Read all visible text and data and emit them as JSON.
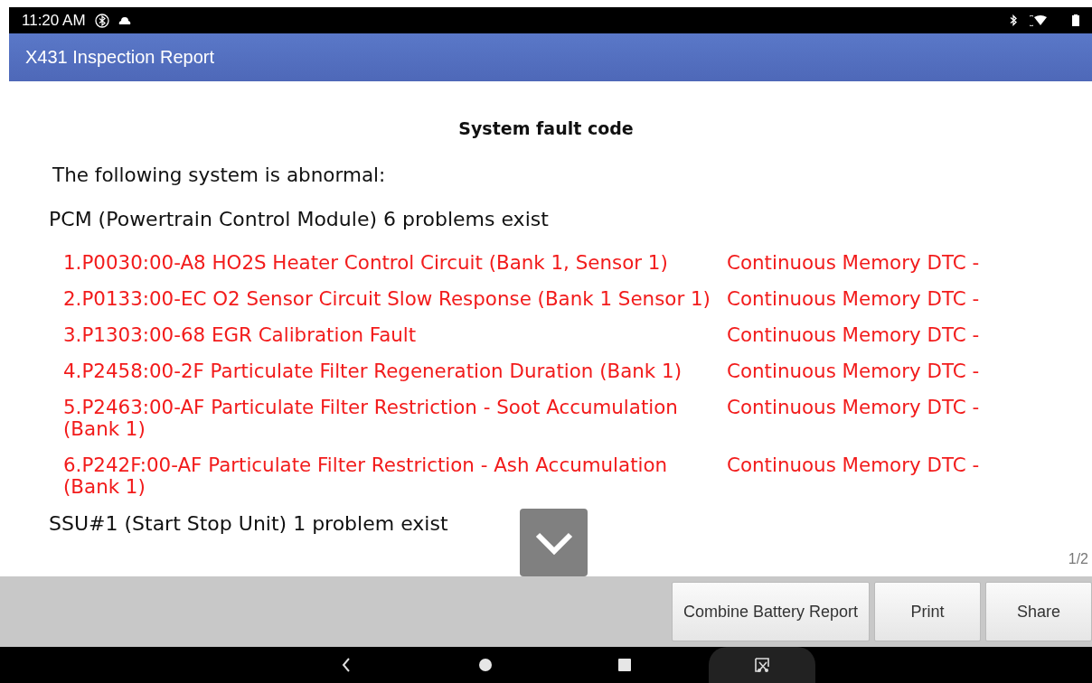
{
  "status_bar": {
    "time": "11:20 AM"
  },
  "app_bar": {
    "title": "X431 Inspection Report"
  },
  "report": {
    "heading": "System fault code",
    "intro": "The following system is abnormal:",
    "systems": [
      {
        "name": "PCM (Powertrain Control Module) 6 problems exist",
        "faults": [
          {
            "code": "1.P0030:00-A8 HO2S Heater Control Circuit (Bank 1, Sensor 1)",
            "status": "Continuous Memory DTC -"
          },
          {
            "code": "2.P0133:00-EC O2 Sensor Circuit Slow Response (Bank 1 Sensor 1)",
            "status": "Continuous Memory DTC -"
          },
          {
            "code": "3.P1303:00-68 EGR Calibration Fault",
            "status": "Continuous Memory DTC -"
          },
          {
            "code": "4.P2458:00-2F Particulate Filter Regeneration Duration (Bank 1)",
            "status": "Continuous Memory DTC -"
          },
          {
            "code": "5.P2463:00-AF Particulate Filter Restriction - Soot Accumulation (Bank 1)",
            "status": "Continuous Memory DTC -"
          },
          {
            "code": "6.P242F:00-AF Particulate Filter Restriction - Ash Accumulation (Bank 1)",
            "status": "Continuous Memory DTC -"
          }
        ]
      },
      {
        "name": "SSU#1 (Start Stop Unit) 1 problem exist"
      }
    ]
  },
  "page_indicator": "1/2",
  "buttons": [
    "Combine Battery Report",
    "Print",
    "Share"
  ]
}
